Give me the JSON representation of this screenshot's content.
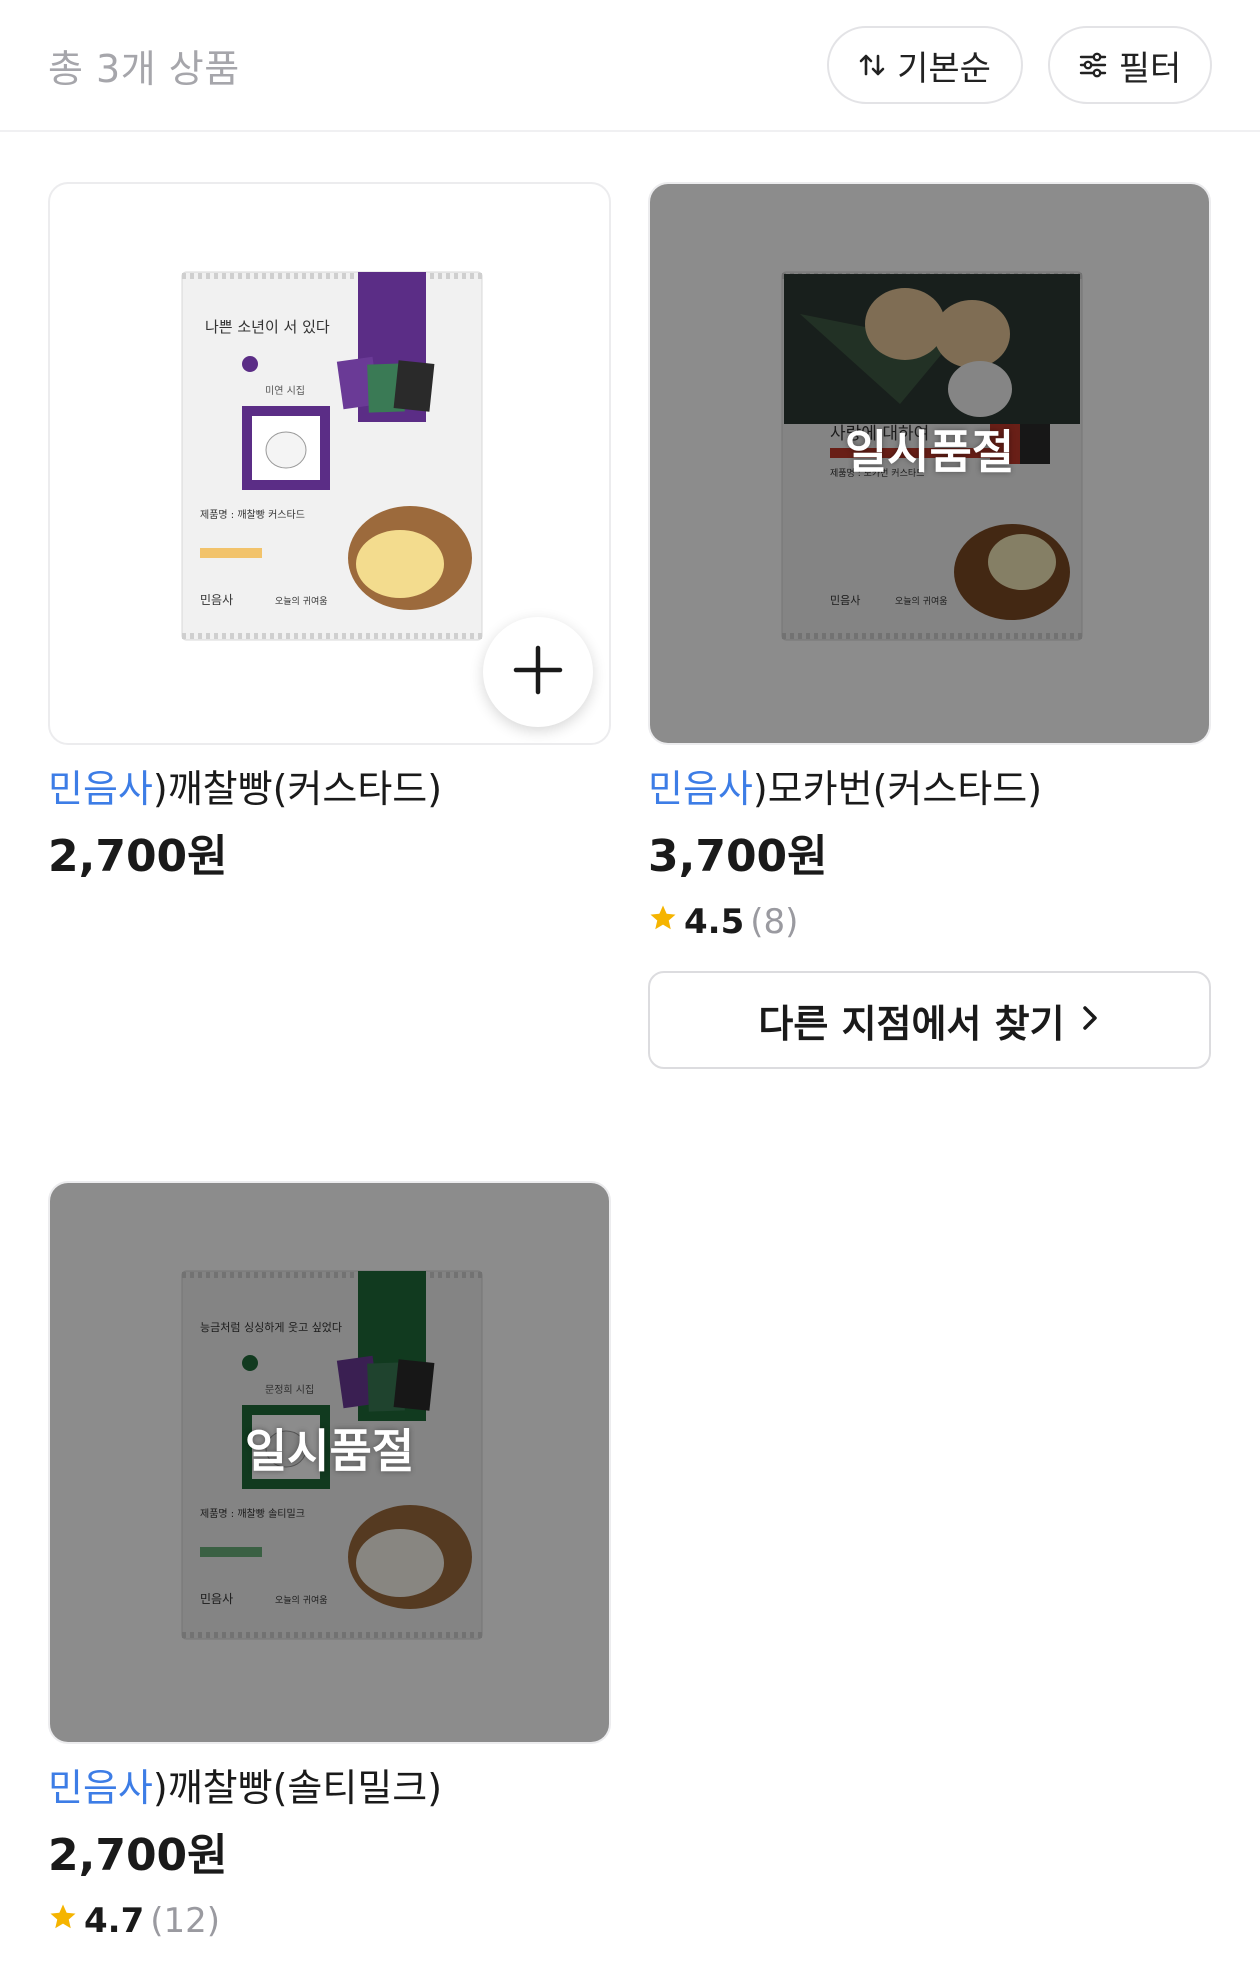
{
  "header": {
    "count_label": "총 3개 상품",
    "sort_label": "기본순",
    "filter_label": "필터",
    "sort_icon": "sort-arrows-icon",
    "filter_icon": "sliders-icon"
  },
  "products": [
    {
      "brand": "민음사",
      "name": ")깨찰빵(커스타드)",
      "price": "2,700원",
      "package_text": {
        "headline": "나쁜 소년이 서 있다",
        "sub": "미연 시집",
        "product": "제품명 : 깨찰빵 커스타드",
        "logo1": "민음사",
        "logo2": "오늘의 귀여움"
      },
      "accent_color": "#5b2d86",
      "sold_out": false,
      "add_icon": "plus-icon"
    },
    {
      "brand": "민음사",
      "name": ")모카번(커스타드)",
      "price": "3,700원",
      "rating": "4.5",
      "reviews": "(8)",
      "sold_out": true,
      "sold_out_label": "일시품절",
      "package_text": {
        "headline": "사랑에 대하여",
        "product": "제품명 : 모카번 커스타드",
        "logo1": "민음사",
        "logo2": "오늘의 귀여움"
      },
      "accent_color": "#c0392b",
      "other_store_label": "다른 지점에서 찾기"
    },
    {
      "brand": "민음사",
      "name": ")깨찰빵(솔티밀크)",
      "price": "2,700원",
      "rating": "4.7",
      "reviews": "(12)",
      "sold_out": true,
      "sold_out_label": "일시품절",
      "package_text": {
        "headline": "능금처럼 싱싱하게 웃고 싶었다",
        "sub": "문정희 시집",
        "product": "제품명 : 깨찰빵 솔티밀크",
        "logo1": "민음사",
        "logo2": "오늘의 귀여움"
      },
      "accent_color": "#1f6b3a"
    }
  ],
  "colors": {
    "brand_blue": "#3d7de6",
    "star": "#f5b400",
    "muted": "#a6a6ab"
  }
}
